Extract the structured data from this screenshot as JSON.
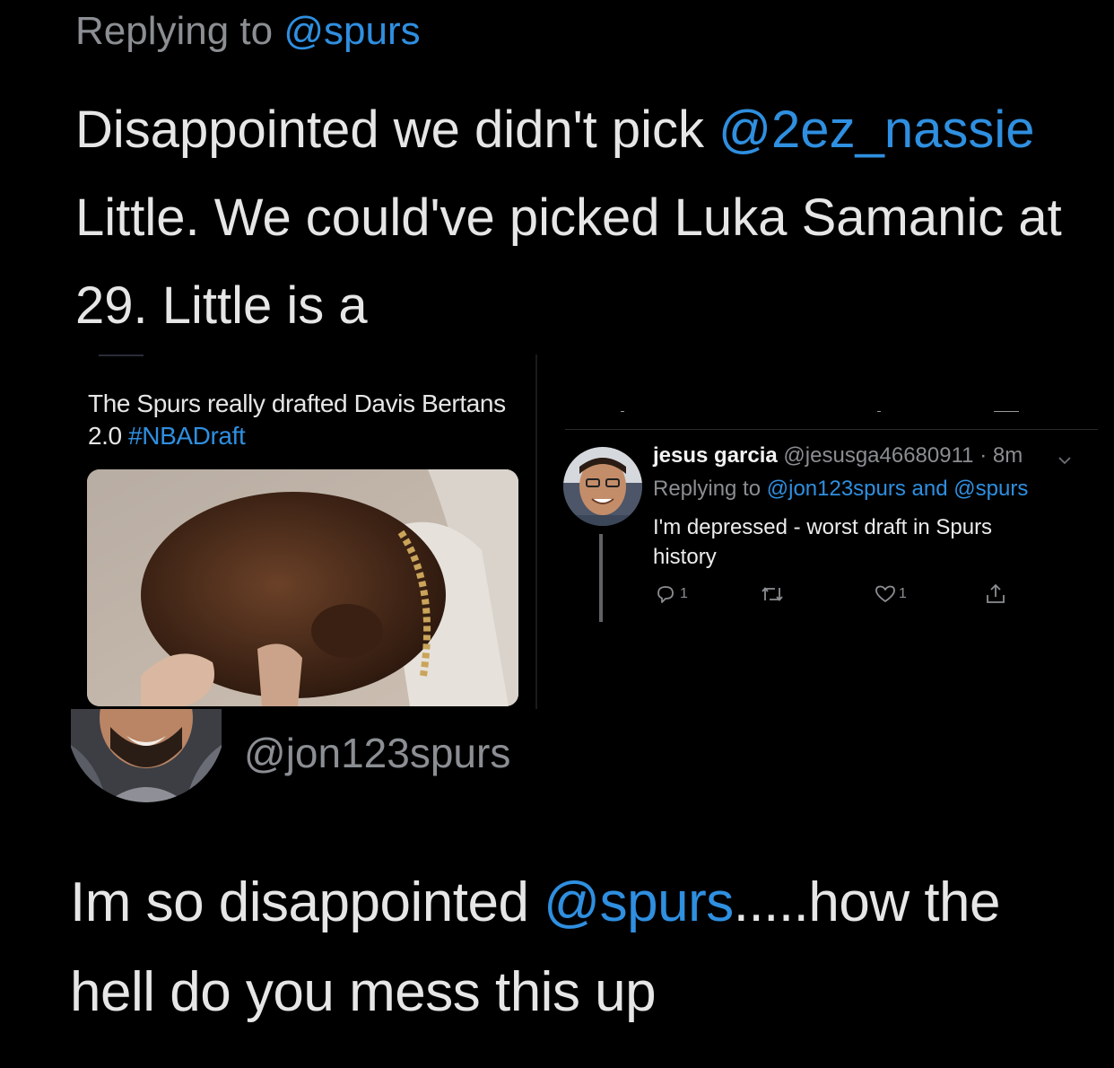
{
  "top_tweet": {
    "replying_prefix": "Replying to",
    "replying_handle": "@spurs",
    "text_1": "Disappointed we didn't pick",
    "mention": "@2ez_nassie",
    "text_2": "Little. We could've picked Luka Samanic at 29. Little is a"
  },
  "left_tweet": {
    "text": "The Spurs really drafted Davis Bertans 2.0",
    "hashtag": "#NBADraft",
    "media_icon": "photo-image"
  },
  "right_tweet": {
    "name": "jesus garcia",
    "handle": "@jesusga46680911",
    "time": "· 8m",
    "replying_prefix": "Replying to",
    "replying_handle_1": "@jon123spurs",
    "replying_and": "and",
    "replying_handle_2": "@spurs",
    "text": "I'm depressed - worst draft in Spurs history",
    "actions": {
      "reply_count": "1",
      "retweet_count": "",
      "like_count": "1"
    },
    "icons": [
      "reply-icon",
      "retweet-icon",
      "like-icon",
      "share-icon",
      "chevron-down-icon"
    ]
  },
  "bottom_tweet": {
    "handle": "@jon123spurs",
    "text_1": "Im so disappointed",
    "mention": "@spurs",
    "text_2": ".....how the hell do you mess this up"
  },
  "colors": {
    "background": "#000000",
    "mention_blue": "#2f8fe0",
    "muted_grey": "#8b8e92"
  }
}
